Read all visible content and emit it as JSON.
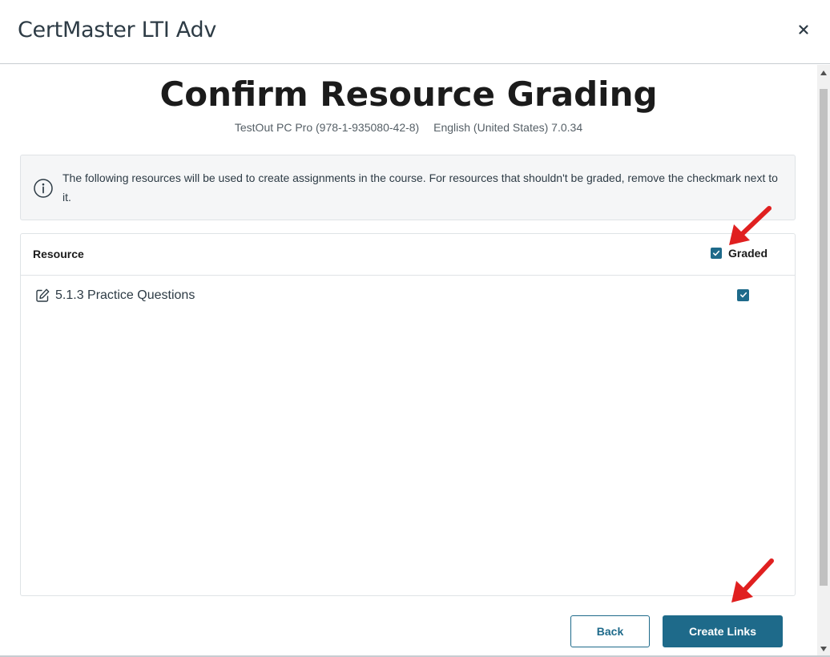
{
  "modal": {
    "title": "CertMaster LTI Adv",
    "close_icon": "close-icon"
  },
  "page": {
    "heading": "Confirm Resource Grading",
    "product": "TestOut PC Pro (978-1-935080-42-8)",
    "locale_version": "English (United States) 7.0.34"
  },
  "info": {
    "icon": "info-icon",
    "text": "The following resources will be used to create assignments in the course. For resources that shouldn't be graded, remove the checkmark next to it."
  },
  "table": {
    "col_resource": "Resource",
    "col_graded": "Graded",
    "header_checked": true,
    "rows": [
      {
        "icon": "edit-icon",
        "label": "5.1.3 Practice Questions",
        "graded": true
      }
    ]
  },
  "footer": {
    "back_label": "Back",
    "create_label": "Create Links"
  },
  "colors": {
    "accent": "#1e6a8a",
    "annotation_arrow": "#e02020"
  }
}
